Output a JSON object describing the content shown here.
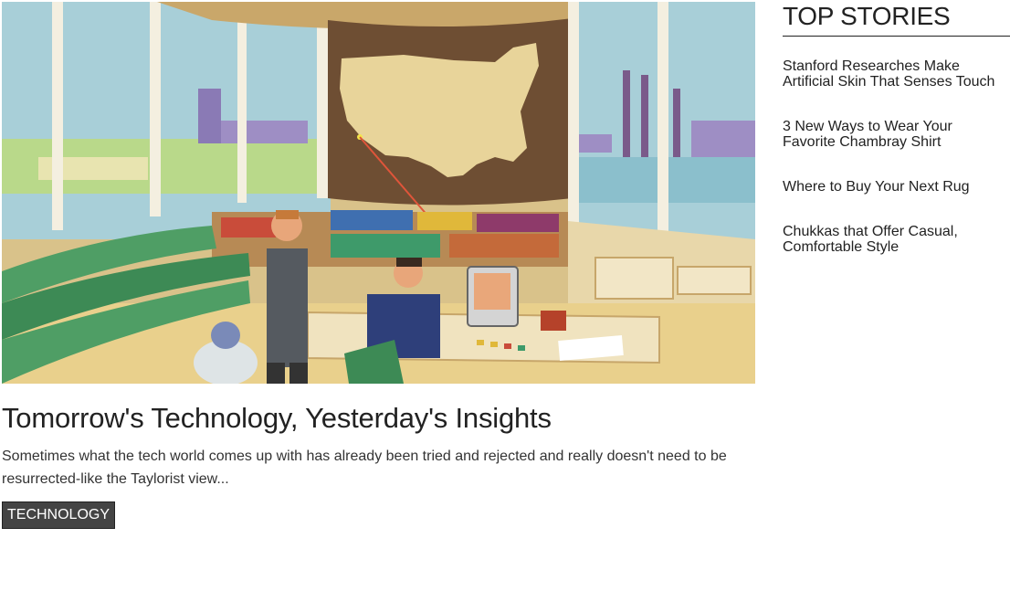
{
  "hero": {
    "image_name": "retro-control-room-illustration"
  },
  "article": {
    "title": "Tomorrow's Technology, Yesterday's Insights",
    "excerpt": "Sometimes what the tech world comes up with has already been tried and rejected and really doesn't need to be resurrected-like the Taylorist view...",
    "tag": "TECHNOLOGY"
  },
  "sidebar": {
    "title": "TOP STORIES",
    "stories": [
      {
        "line1": "Stanford Researches Make",
        "line2": "Artificial Skin That Senses Touch"
      },
      {
        "line1": "3 New Ways to Wear Your",
        "line2": "Favorite Chambray Shirt"
      },
      {
        "line1": "Where to Buy Your Next Rug",
        "line2": ""
      },
      {
        "line1": "Chukkas that Offer Casual,",
        "line2": "Comfortable Style"
      }
    ]
  },
  "colors": {
    "tag_background": "#444444",
    "text": "#222222"
  }
}
